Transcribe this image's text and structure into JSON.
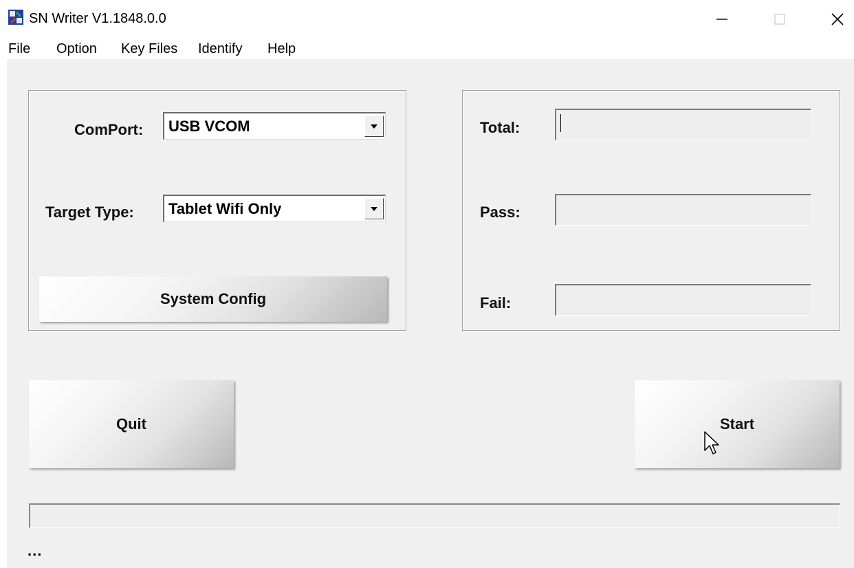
{
  "window": {
    "title": "SN Writer V1.1848.0.0",
    "controls": {
      "minimize": "minimize",
      "maximize": "maximize",
      "close": "close"
    }
  },
  "menu": {
    "items": [
      "File",
      "Option",
      "Key Files",
      "Identify",
      "Help"
    ]
  },
  "config_panel": {
    "comport_label": "ComPort:",
    "comport_value": "USB VCOM",
    "target_type_label": "Target Type:",
    "target_type_value": "Tablet Wifi Only",
    "system_config_label": "System Config"
  },
  "stats_panel": {
    "total_label": "Total:",
    "total_value": "",
    "pass_label": "Pass:",
    "pass_value": "",
    "fail_label": "Fail:",
    "fail_value": ""
  },
  "actions": {
    "quit_label": "Quit",
    "start_label": "Start"
  },
  "progress": {
    "value_percent": 0
  },
  "status": {
    "text": "..."
  },
  "icons": {
    "app": "app-icon",
    "minimize": "minimize-icon",
    "maximize": "maximize-icon",
    "close": "close-icon",
    "dropdown": "chevron-down-icon",
    "cursor": "mouse-pointer-icon"
  }
}
